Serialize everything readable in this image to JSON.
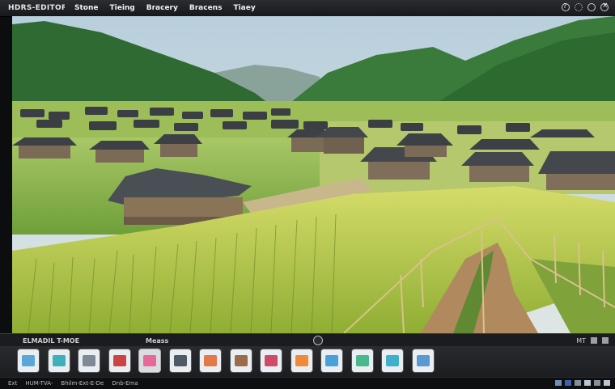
{
  "app": {
    "title": "HDRS-EDITOR"
  },
  "menu": {
    "items": [
      "Stone",
      "Tieing",
      "Bracery",
      "Bracens",
      "Tiaey"
    ]
  },
  "window_controls": {
    "icons": [
      "help-icon",
      "settings-icon",
      "minimize-icon",
      "close-icon"
    ]
  },
  "viewport": {
    "description_icon": "image-canvas"
  },
  "status": {
    "left_label": "ELMADIL T-MOE",
    "mid_label": "Meass",
    "right_label": "MT"
  },
  "thumbnails": [
    {
      "name": "thumb-1",
      "color": "#5aa7d8"
    },
    {
      "name": "thumb-2",
      "color": "#3fb0b8"
    },
    {
      "name": "thumb-3",
      "color": "#7f8a96"
    },
    {
      "name": "thumb-4",
      "color": "#c44"
    },
    {
      "name": "thumb-5",
      "color": "#e56a9b"
    },
    {
      "name": "thumb-6",
      "color": "#4e5a66"
    },
    {
      "name": "thumb-7",
      "color": "#e3794a"
    },
    {
      "name": "thumb-8",
      "color": "#9b6b4a"
    },
    {
      "name": "thumb-9",
      "color": "#d04a6a"
    },
    {
      "name": "thumb-10",
      "color": "#f08a3a"
    },
    {
      "name": "thumb-11",
      "color": "#4aa0d8"
    },
    {
      "name": "thumb-12",
      "color": "#4ab88a"
    },
    {
      "name": "thumb-13",
      "color": "#3fb0c8"
    },
    {
      "name": "thumb-14",
      "color": "#5a9ad0"
    }
  ],
  "bottom": {
    "items": [
      "Ext",
      "HUM-TVA-",
      "Bhilm-Ext-E-De",
      "Dnb-Ema"
    ]
  },
  "colors": {
    "accent": "#3e62b0",
    "frame": "#0c0d0f"
  }
}
